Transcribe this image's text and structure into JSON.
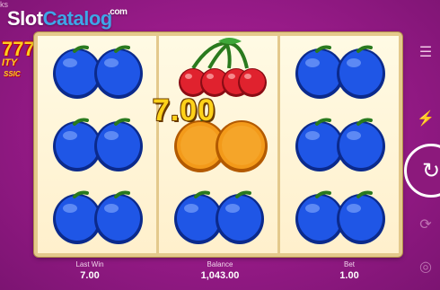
{
  "watermark": {
    "left_text": "ks",
    "brand_part1": "Slot",
    "brand_part2": "Catalog",
    "domain": ".com"
  },
  "game_logo": {
    "sevens": "777",
    "line1": "ITY",
    "line2": "SSIC"
  },
  "reels": [
    [
      "plum",
      "plum",
      "plum"
    ],
    [
      "cherry",
      "orange",
      "plum"
    ],
    [
      "plum",
      "plum",
      "plum"
    ]
  ],
  "win_display": "7.00",
  "stats": {
    "last_win": {
      "label": "Last Win",
      "value": "7.00"
    },
    "balance": {
      "label": "Balance",
      "value": "1,043.00"
    },
    "bet": {
      "label": "Bet",
      "value": "1.00"
    }
  },
  "icons": {
    "menu": "menu-icon",
    "turbo": "lightning-icon",
    "spin": "spin-arrow-icon",
    "autoplay": "autoplay-icon",
    "coins": "coins-icon"
  },
  "colors": {
    "background": "#951a86",
    "board": "#e4c98c",
    "reel": "#fff5d8",
    "plum": "#1f56e6",
    "cherry": "#e0222e",
    "orange": "#f39a1a",
    "win_text": "#ffd21a"
  }
}
